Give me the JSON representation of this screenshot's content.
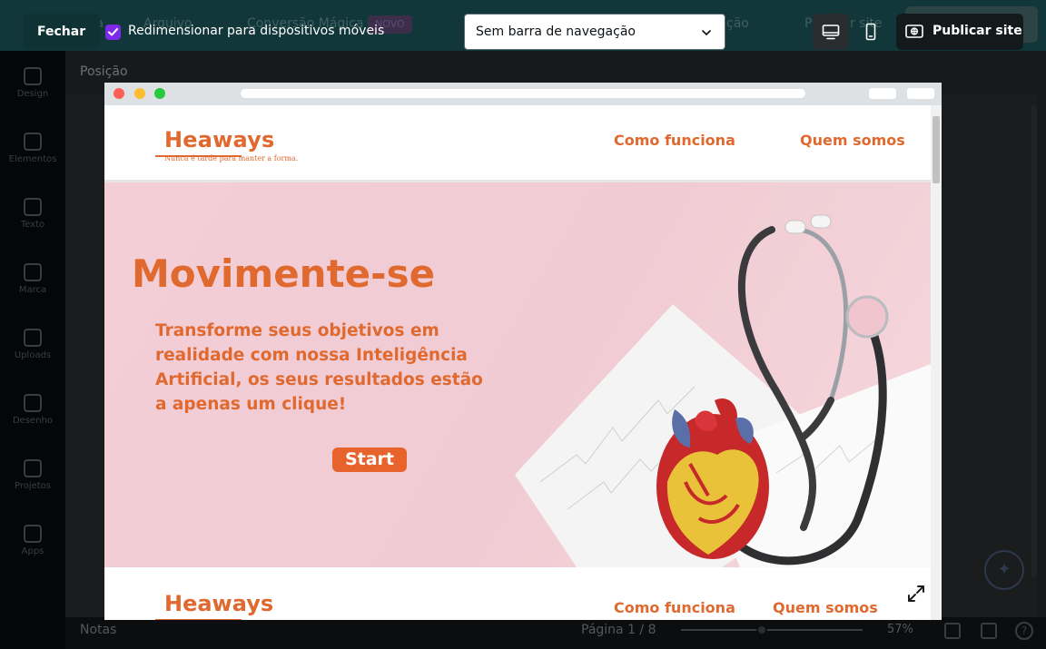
{
  "background_editor": {
    "ghost_top_items": [
      "ícia",
      "Arquivo",
      "Conversão Mágica",
      "ção",
      "Publicar site"
    ],
    "ghost_badge": "NOVO",
    "ghost_share": "Compartilhar",
    "panel_label": "Posição",
    "rail": [
      {
        "label": "Design",
        "icon": "layout-icon"
      },
      {
        "label": "Elementos",
        "icon": "shapes-icon"
      },
      {
        "label": "Texto",
        "icon": "text-icon"
      },
      {
        "label": "Marca",
        "icon": "brand-icon"
      },
      {
        "label": "Uploads",
        "icon": "upload-icon"
      },
      {
        "label": "Desenho",
        "icon": "pen-icon"
      },
      {
        "label": "Projetos",
        "icon": "folder-icon"
      },
      {
        "label": "Apps",
        "icon": "apps-icon"
      }
    ],
    "bottom": {
      "notes": "Notas",
      "page": "Página 1 / 8",
      "zoom": "57%",
      "zoom_level": 0.57,
      "help": "?"
    }
  },
  "preview_toolbar": {
    "close_label": "Fechar",
    "resize_checkbox_checked": true,
    "resize_label": "Redimensionar para dispositivos móveis",
    "nav_select_value": "Sem barra de navegação",
    "device_active": "desktop",
    "publish_label": "Publicar site"
  },
  "site": {
    "logo": "Heaways",
    "tagline": "Nunca é tarde para manter a forma.",
    "nav": [
      "Como funciona",
      "Quem somos"
    ],
    "hero_title": "Movimente-se",
    "hero_text": "Transforme seus objetivos em realidade com nossa Inteligência Artificial, os seus resultados estão a apenas um clique!",
    "hero_button": "Start",
    "footer_logo": "Heaways",
    "footer_nav": [
      "Como funciona",
      "Quem somos"
    ]
  },
  "colors": {
    "brand_orange": "#e0692f",
    "hero_pink": "#f3ced6",
    "checkbox_purple": "#7d2ae8",
    "toolbar_teal": "#12373a"
  }
}
